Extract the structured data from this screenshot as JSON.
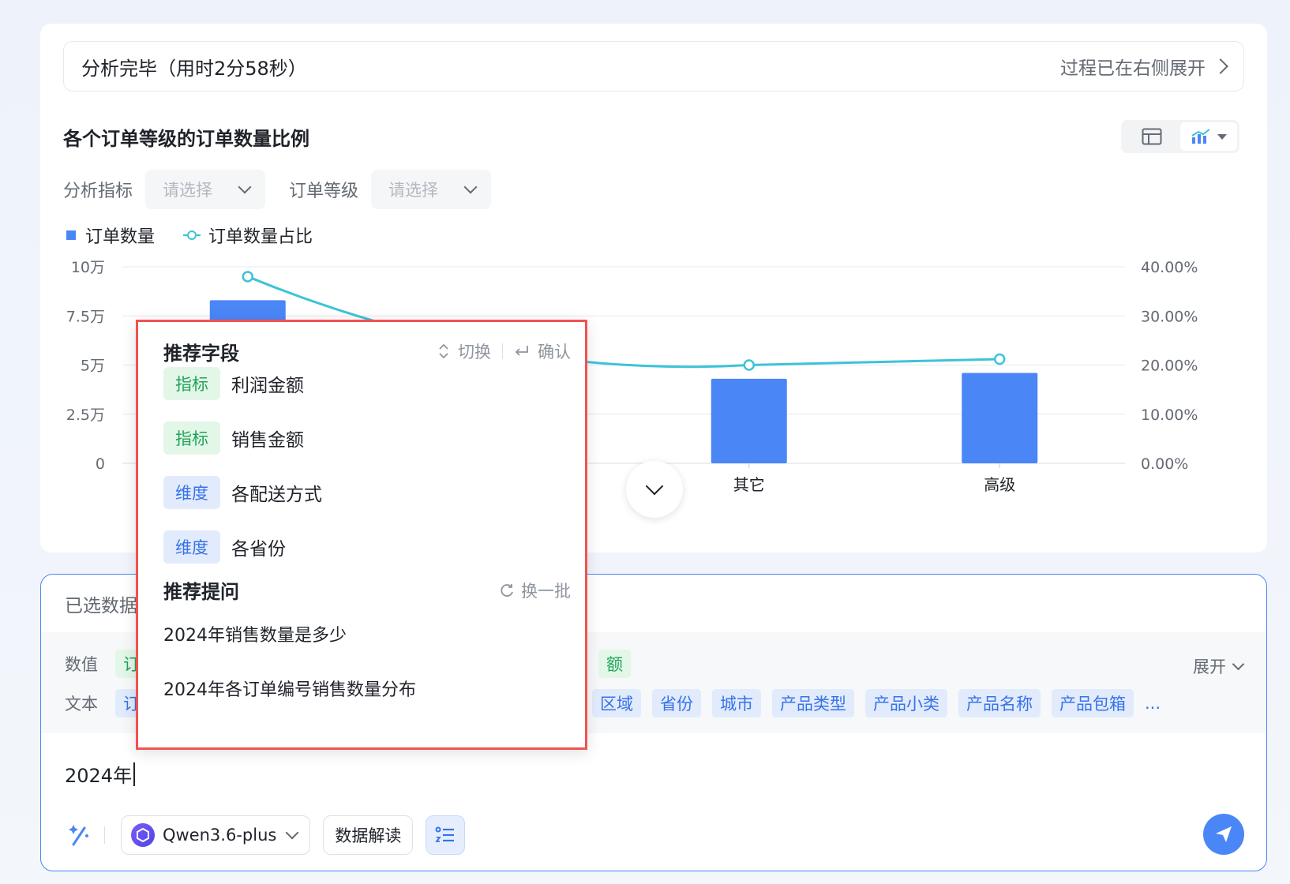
{
  "status": {
    "title": "分析完毕（用时2分58秒）",
    "right_text": "过程已在右侧展开"
  },
  "chart_header": {
    "title": "各个订单等级的订单数量比例"
  },
  "filters": [
    {
      "label": "分析指标",
      "placeholder": "请选择"
    },
    {
      "label": "订单等级",
      "placeholder": "请选择"
    }
  ],
  "legend": {
    "bar": "订单数量",
    "line": "订单数量占比"
  },
  "chart_data": {
    "type": "bar",
    "categories": [
      "",
      "",
      "其它",
      "高级"
    ],
    "series": [
      {
        "name": "订单数量",
        "type": "bar",
        "values": [
          83000,
          null,
          43000,
          46000
        ]
      },
      {
        "name": "订单数量占比",
        "type": "line",
        "values": [
          0.38,
          null,
          0.2,
          0.212
        ]
      }
    ],
    "y_left": {
      "ticks": [
        "10万",
        "7.5万",
        "5万",
        "2.5万",
        "0"
      ],
      "range": [
        0,
        100000
      ]
    },
    "y_right": {
      "ticks": [
        "40.00%",
        "30.00%",
        "20.00%",
        "10.00%",
        "0.00%"
      ],
      "range": [
        0,
        0.4
      ]
    },
    "colors": {
      "bar": "#4b86f7",
      "line": "#3dc3d8",
      "grid": "#e6e9ef"
    },
    "grid": true,
    "legend_position": "top-left"
  },
  "popover": {
    "fields_title": "推荐字段",
    "hint_switch": "切换",
    "hint_confirm": "确认",
    "fields": [
      {
        "tag": "指标",
        "tag_type": "green",
        "name": "利润金额"
      },
      {
        "tag": "指标",
        "tag_type": "green",
        "name": "销售金额"
      },
      {
        "tag": "维度",
        "tag_type": "blue",
        "name": "各配送方式"
      },
      {
        "tag": "维度",
        "tag_type": "blue",
        "name": "各省份"
      }
    ],
    "questions_title": "推荐提问",
    "refresh_label": "换一批",
    "questions": [
      "2024年销售数量是多少",
      "2024年各订单编号销售数量分布"
    ]
  },
  "input_panel": {
    "header": "已选数据",
    "numeric_label": "数值",
    "numeric_chips": [
      "订",
      "额"
    ],
    "text_label": "文本",
    "text_chips_left": [
      "订"
    ],
    "text_chips": [
      "区域",
      "省份",
      "城市",
      "产品类型",
      "产品小类",
      "产品名称",
      "产品包箱"
    ],
    "more": "...",
    "expand_label": "展开",
    "input_value": "2024年",
    "model_name": "Qwen3.6-plus",
    "data_interpret_label": "数据解读"
  }
}
